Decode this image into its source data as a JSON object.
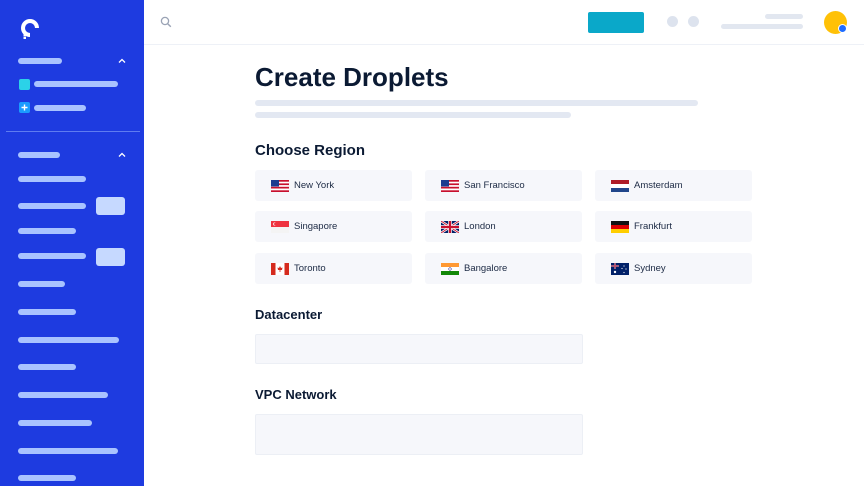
{
  "page": {
    "title": "Create Droplets"
  },
  "sections": {
    "region": "Choose Region",
    "datacenter": "Datacenter",
    "vpc": "VPC Network"
  },
  "regions": [
    {
      "label": "New York",
      "flag": "us-flag-icon"
    },
    {
      "label": "San Francisco",
      "flag": "us-flag-icon"
    },
    {
      "label": "Amsterdam",
      "flag": "nl-flag-icon"
    },
    {
      "label": "Singapore",
      "flag": "sg-flag-icon"
    },
    {
      "label": "London",
      "flag": "uk-flag-icon"
    },
    {
      "label": "Frankfurt",
      "flag": "de-flag-icon"
    },
    {
      "label": "Toronto",
      "flag": "ca-flag-icon"
    },
    {
      "label": "Bangalore",
      "flag": "in-flag-icon"
    },
    {
      "label": "Sydney",
      "flag": "au-flag-icon"
    }
  ],
  "colors": {
    "sidebar": "#1e3be0",
    "accent_button": "#0aa8c9",
    "avatar": "#ffc107",
    "avatar_status": "#1e6cff"
  },
  "icons": {
    "logo": "digitalocean-logo-icon",
    "search": "search-icon",
    "chevron": "chevron-up-icon",
    "add": "plus-icon"
  }
}
